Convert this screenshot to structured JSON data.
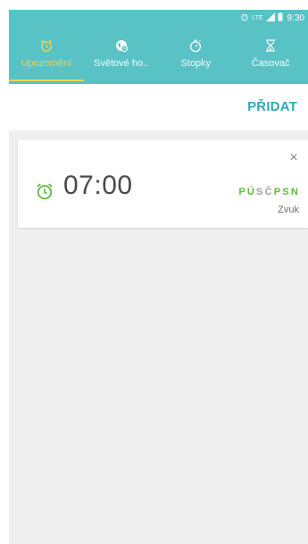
{
  "status_bar": {
    "time": "9:30",
    "icons": [
      "alarm-icon",
      "lte-icon",
      "signal-icon",
      "battery-icon"
    ]
  },
  "tabs": [
    {
      "label": "Upozornění",
      "icon": "alarm-clock-icon",
      "active": true
    },
    {
      "label": "Světové ho..",
      "icon": "globe-icon",
      "active": false
    },
    {
      "label": "Stopky",
      "icon": "stopwatch-icon",
      "active": false
    },
    {
      "label": "Časovač",
      "icon": "hourglass-icon",
      "active": false
    }
  ],
  "toolbar": {
    "add_label": "PŘIDAT"
  },
  "alarm": {
    "time": "07:00",
    "days": [
      {
        "letter": "P",
        "active": true
      },
      {
        "letter": "Ú",
        "active": true
      },
      {
        "letter": "S",
        "active": false
      },
      {
        "letter": "Č",
        "active": false
      },
      {
        "letter": "P",
        "active": true
      },
      {
        "letter": "S",
        "active": true
      },
      {
        "letter": "N",
        "active": true
      }
    ],
    "sound_label": "Zvuk",
    "close_symbol": "×"
  },
  "colors": {
    "header": "#58c2c5",
    "accent_tab": "#f2d35b",
    "add_button": "#2fa8b6",
    "alarm_green": "#5bbd3a",
    "day_inactive": "#9aa0a6",
    "background": "#efefef"
  }
}
